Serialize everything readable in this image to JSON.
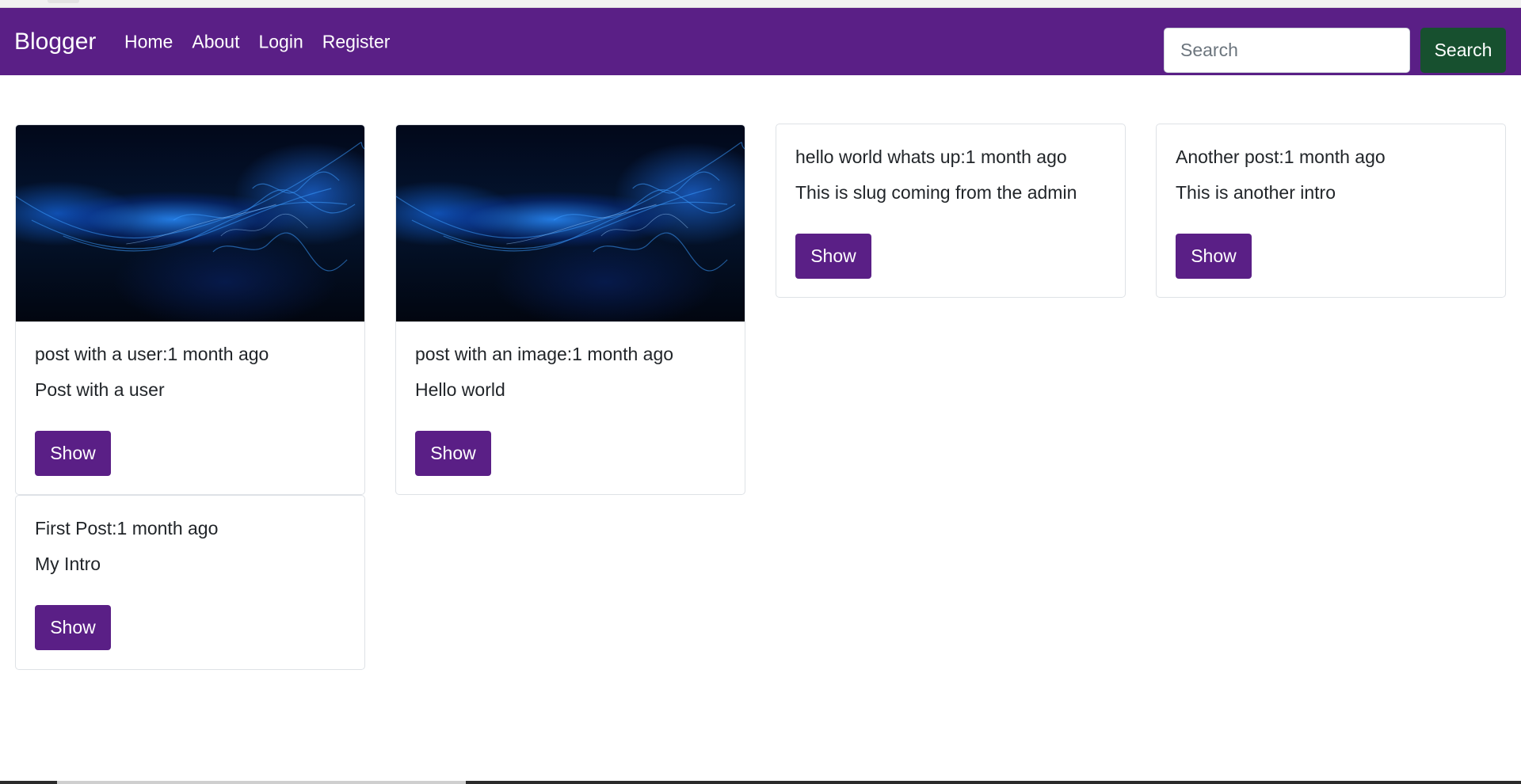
{
  "navbar": {
    "brand": "Blogger",
    "links": [
      "Home",
      "About",
      "Login",
      "Register"
    ],
    "search_placeholder": "Search",
    "search_button": "Search"
  },
  "posts": [
    {
      "title": "post with a user:1 month ago",
      "intro": "Post with a user",
      "button": "Show",
      "has_image": true
    },
    {
      "title": "post with an image:1 month ago",
      "intro": "Hello world",
      "button": "Show",
      "has_image": true
    },
    {
      "title": "hello world whats up:1 month ago",
      "intro": "This is slug coming from the admin",
      "button": "Show",
      "has_image": false
    },
    {
      "title": "Another post:1 month ago",
      "intro": "This is another intro",
      "button": "Show",
      "has_image": false
    },
    {
      "title": "First Post:1 month ago",
      "intro": "My Intro",
      "button": "Show",
      "has_image": false
    }
  ],
  "colors": {
    "navbar_bg": "#5a1f86",
    "search_button_bg": "#17502f",
    "show_button_bg": "#5a1f86"
  }
}
